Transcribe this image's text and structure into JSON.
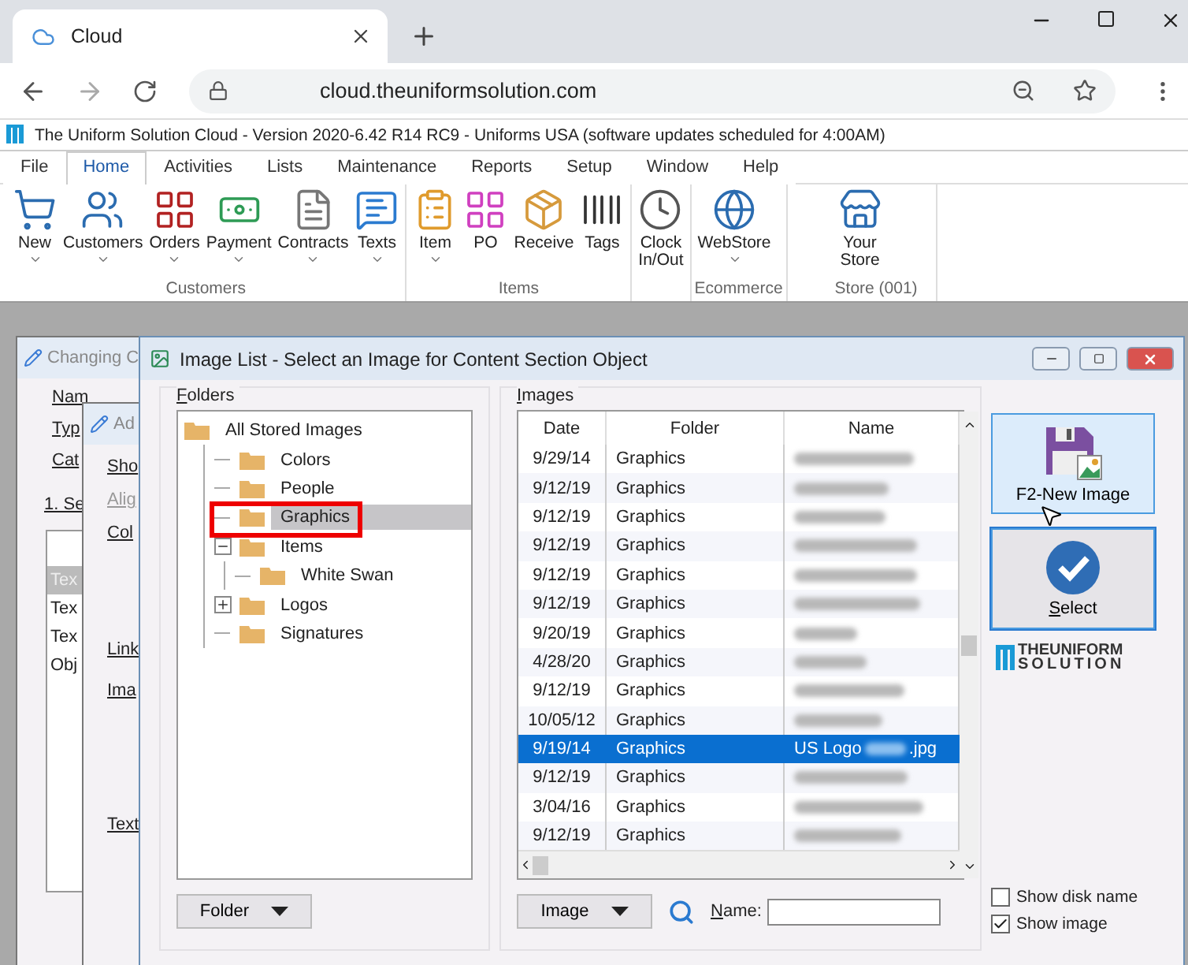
{
  "browser": {
    "tab_title": "Cloud",
    "url": "cloud.theuniformsolution.com"
  },
  "app": {
    "title": "The Uniform Solution Cloud - Version 2020-6.42 R14 RC9 - Uniforms USA (software updates scheduled for  4:00AM)"
  },
  "menu": [
    {
      "label": "File",
      "selected": false
    },
    {
      "label": "Home",
      "selected": true
    },
    {
      "label": "Activities",
      "selected": false
    },
    {
      "label": "Lists",
      "selected": false
    },
    {
      "label": "Maintenance",
      "selected": false
    },
    {
      "label": "Reports",
      "selected": false
    },
    {
      "label": "Setup",
      "selected": false
    },
    {
      "label": "Window",
      "selected": false
    },
    {
      "label": "Help",
      "selected": false
    }
  ],
  "ribbon": [
    {
      "label": "Customers",
      "buttons": [
        {
          "label": "New",
          "dropdown": true
        },
        {
          "label": "Customers",
          "dropdown": true
        },
        {
          "label": "Orders",
          "dropdown": true
        },
        {
          "label": "Payment",
          "dropdown": true
        },
        {
          "label": "Contracts",
          "dropdown": true
        },
        {
          "label": "Texts",
          "dropdown": true
        }
      ]
    },
    {
      "label": "Items",
      "buttons": [
        {
          "label": "Item",
          "dropdown": true
        },
        {
          "label": "PO",
          "dropdown": false
        },
        {
          "label": "Receive",
          "dropdown": false
        },
        {
          "label": "Tags",
          "dropdown": false
        }
      ]
    },
    {
      "buttons": [
        {
          "label": "Clock In/Out",
          "dropdown": false
        }
      ]
    },
    {
      "label": "Ecommerce",
      "buttons": [
        {
          "label": "WebStore",
          "dropdown": true
        }
      ]
    },
    {
      "label": "Store (001)",
      "buttons": [
        {
          "label": "Your Store",
          "dropdown": false
        }
      ]
    }
  ],
  "background_windows": [
    {
      "title": "Changing C",
      "fields": [
        "Nam",
        "Typ",
        "Cat"
      ],
      "tab": "1. Se",
      "list": [
        {
          "label": "Tex",
          "selected": true
        },
        {
          "label": "Tex",
          "selected": false
        },
        {
          "label": "Tex",
          "selected": false
        },
        {
          "label": "Obj",
          "selected": false
        }
      ]
    },
    {
      "title": "Ad",
      "fields": [
        {
          "label": "Sho",
          "disabled": false
        },
        {
          "label": "Alig",
          "disabled": true
        },
        {
          "label": "Col",
          "disabled": false
        },
        {
          "label": "Link",
          "disabled": false
        },
        {
          "label": "Ima",
          "disabled": false
        },
        {
          "label": "Text",
          "disabled": false
        }
      ]
    }
  ],
  "dialog": {
    "title": "Image List - Select an Image for Content Section Object",
    "folders": {
      "title": "Folders",
      "button": "Folder",
      "tree": {
        "label": "All Stored Images",
        "selected": false,
        "children": [
          {
            "label": "Colors",
            "selected": false
          },
          {
            "label": "People",
            "selected": false
          },
          {
            "label": "Graphics",
            "selected": true
          },
          {
            "label": "Items",
            "selected": false,
            "expanded": true,
            "children": [
              {
                "label": "White Swan",
                "selected": false
              }
            ]
          },
          {
            "label": "Logos",
            "selected": false,
            "expanded": false
          },
          {
            "label": "Signatures",
            "selected": false
          }
        ]
      }
    },
    "images": {
      "title": "Images",
      "columns": [
        "Date",
        "Folder",
        "Name"
      ],
      "button": "Image",
      "search_label": "Name:",
      "rows": [
        {
          "date": "9/29/14",
          "folder": "Graphics",
          "selected": false
        },
        {
          "date": "9/12/19",
          "folder": "Graphics",
          "selected": false
        },
        {
          "date": "9/12/19",
          "folder": "Graphics",
          "selected": false
        },
        {
          "date": "9/12/19",
          "folder": "Graphics",
          "selected": false
        },
        {
          "date": "9/12/19",
          "folder": "Graphics",
          "selected": false
        },
        {
          "date": "9/12/19",
          "folder": "Graphics",
          "selected": false
        },
        {
          "date": "9/20/19",
          "folder": "Graphics",
          "selected": false
        },
        {
          "date": "4/28/20",
          "folder": "Graphics",
          "selected": false
        },
        {
          "date": "9/12/19",
          "folder": "Graphics",
          "selected": false
        },
        {
          "date": "10/05/12",
          "folder": "Graphics",
          "selected": false
        },
        {
          "date": "9/19/14",
          "folder": "Graphics",
          "name": "US Logo",
          "name_end": ".jpg",
          "selected": true
        },
        {
          "date": "9/12/19",
          "folder": "Graphics",
          "selected": false
        },
        {
          "date": "3/04/16",
          "folder": "Graphics",
          "selected": false
        },
        {
          "date": "9/12/19",
          "folder": "Graphics",
          "selected": false
        }
      ]
    },
    "new_image_button": "F2-New Image",
    "select_button": "Select",
    "logo": {
      "line1": "THEUNIFORM",
      "line2": "SOLUTION"
    },
    "checkboxes": [
      {
        "label": "Show disk name",
        "checked": false
      },
      {
        "label": "Show image",
        "checked": true
      }
    ]
  }
}
